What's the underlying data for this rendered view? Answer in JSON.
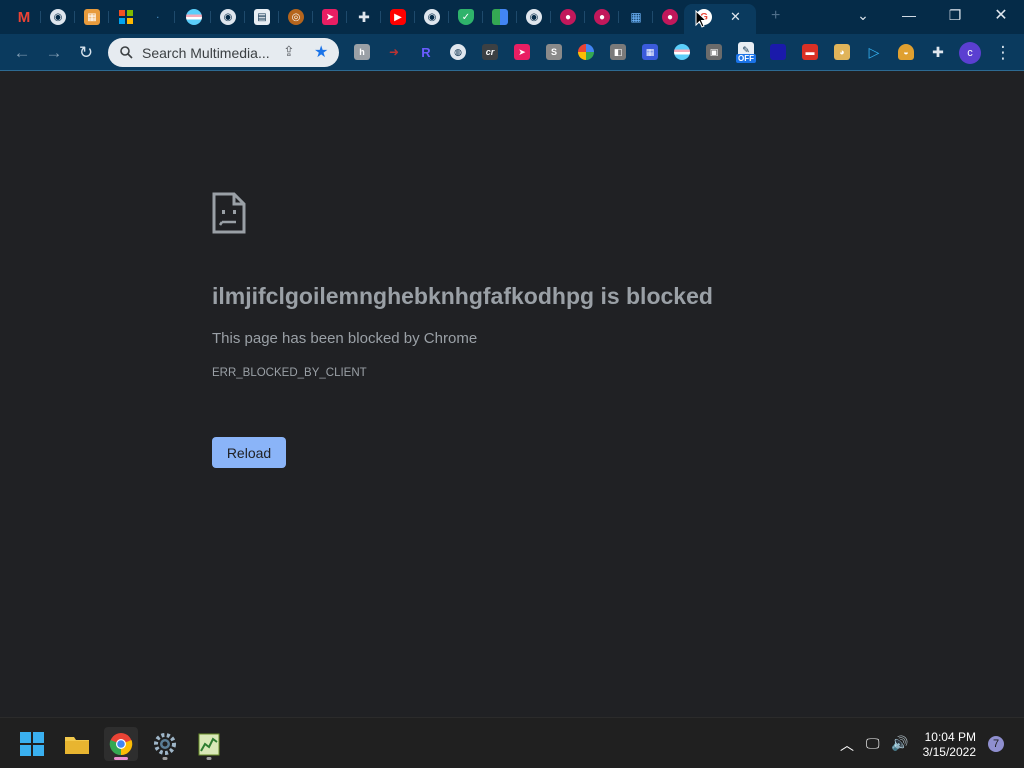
{
  "browser": {
    "tabs_favicons": [
      "gmail-icon",
      "globe-icon",
      "archive-icon",
      "microsoft-icon",
      "blank-icon",
      "flag-icon",
      "globe-icon",
      "document-icon",
      "podcast-icon",
      "pointer-icon",
      "puzzle-icon",
      "youtube-icon",
      "globe-icon",
      "shield-icon",
      "sheets-icon",
      "globe-icon",
      "pink-circle-icon",
      "pink-circle-icon",
      "grid-icon",
      "pink-circle-icon",
      "google-icon"
    ],
    "active_tab_close": "✕",
    "new_tab_label": "+",
    "window_controls": {
      "dropdown": "⌄",
      "minimize": "—",
      "restore": "❐",
      "close": "✕"
    }
  },
  "toolbar": {
    "back_label": "←",
    "forward_label": "→",
    "reload_label": "↻",
    "omnibox_text": "Search Multimedia...",
    "share_label": "⇪",
    "bookmark_label": "★",
    "profile_initial": "c",
    "menu_label": "⋮",
    "extension_off_badge": "OFF"
  },
  "error_page": {
    "title": "ilmjifclgoilemnghebknhgfafkodhpg is blocked",
    "description": "This page has been blocked by Chrome",
    "error_code": "ERR_BLOCKED_BY_CLIENT",
    "reload_label": "Reload"
  },
  "taskbar": {
    "time": "10:04 PM",
    "date": "3/15/2022",
    "notification_count": "7"
  },
  "colors": {
    "titlebar": "#052b48",
    "toolbar": "#0a3a5e",
    "page_bg": "#202124",
    "reload_button": "#8ab4f8",
    "taskbar": "#202020"
  }
}
